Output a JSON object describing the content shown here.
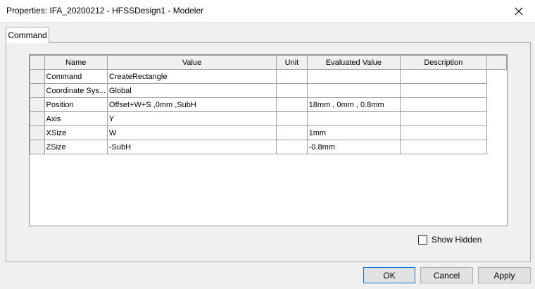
{
  "window": {
    "title": "Properties: IFA_20200212 - HFSSDesign1 - Modeler"
  },
  "tabs": [
    {
      "label": "Command"
    }
  ],
  "table": {
    "columns": [
      "Name",
      "Value",
      "Unit",
      "Evaluated Value",
      "Description"
    ],
    "rows": [
      {
        "name": "Command",
        "value": "CreateRectangle",
        "unit": "",
        "evaluated": "",
        "description": ""
      },
      {
        "name": "Coordinate Sys...",
        "value": "Global",
        "unit": "",
        "evaluated": "",
        "description": ""
      },
      {
        "name": "Position",
        "value": "Offset+W+S ,0mm ,SubH",
        "unit": "",
        "evaluated": "18mm , 0mm , 0.8mm",
        "description": ""
      },
      {
        "name": "Axis",
        "value": "Y",
        "unit": "",
        "evaluated": "",
        "description": ""
      },
      {
        "name": "XSize",
        "value": "W",
        "unit": "",
        "evaluated": "1mm",
        "description": ""
      },
      {
        "name": "ZSize",
        "value": "-SubH",
        "unit": "",
        "evaluated": "-0.8mm",
        "description": ""
      }
    ]
  },
  "options": {
    "show_hidden_label": "Show Hidden",
    "show_hidden_checked": false
  },
  "buttons": {
    "ok": "OK",
    "cancel": "Cancel",
    "apply": "Apply"
  }
}
